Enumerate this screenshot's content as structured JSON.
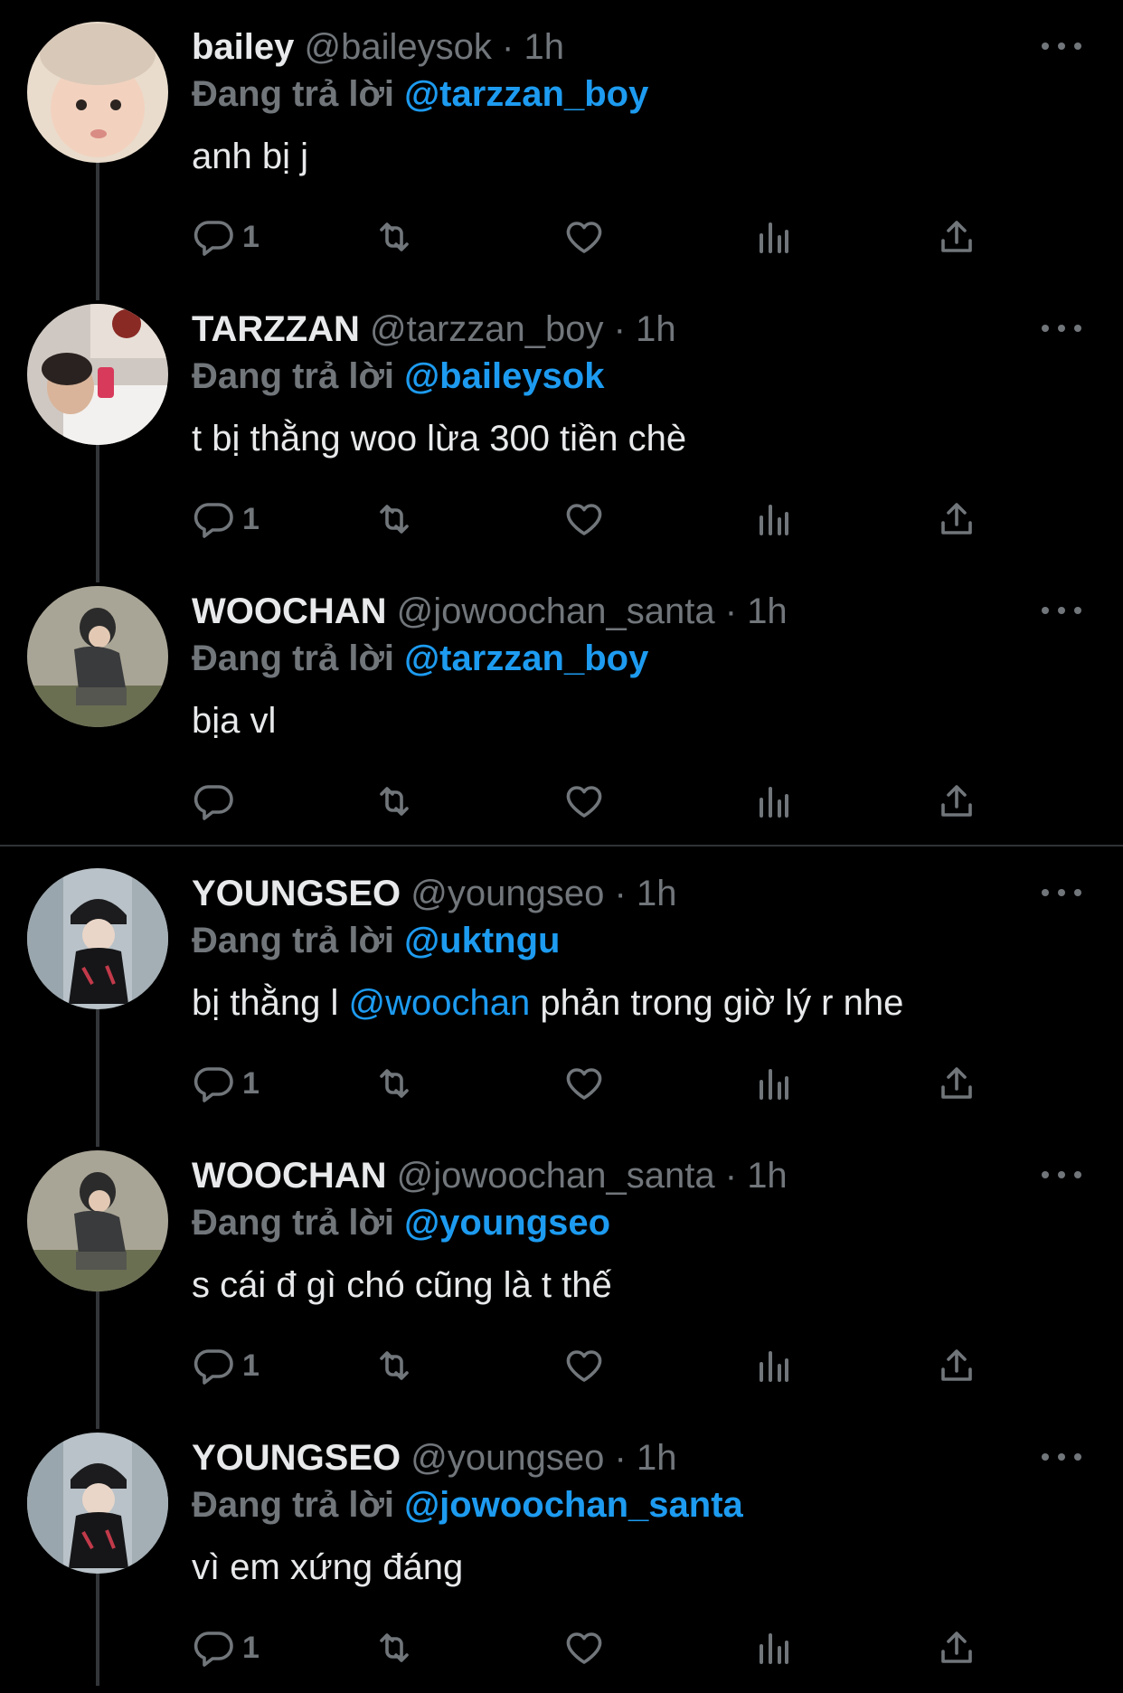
{
  "colors": {
    "background": "#000000",
    "text": "#e7e9ea",
    "muted": "#71767b",
    "accent": "#1d9bf0"
  },
  "tweets": [
    {
      "display_name": "bailey",
      "handle": "@baileysok",
      "dot": "·",
      "time": "1h",
      "reply_prefix": "Đang trả lời",
      "reply_to": "@tarzzan_boy",
      "text": "anh bị j",
      "reply_count": "1",
      "avatar": "avatar-baby"
    },
    {
      "display_name": "TARZZAN",
      "handle": "@tarzzan_boy",
      "dot": "·",
      "time": "1h",
      "reply_prefix": "Đang trả lời",
      "reply_to": "@baileysok",
      "text": "t bị thằng woo lừa 300 tiền chè",
      "reply_count": "1",
      "avatar": "avatar-mirror-selfie"
    },
    {
      "display_name": "WOOCHAN",
      "handle": "@jowoochan_santa",
      "dot": "·",
      "time": "1h",
      "reply_prefix": "Đang trả lời",
      "reply_to": "@tarzzan_boy",
      "text": "bịa vl",
      "reply_count": "",
      "avatar": "avatar-crouching"
    },
    {
      "display_name": "YOUNGSEO",
      "handle": "@youngseo",
      "dot": "·",
      "time": "1h",
      "reply_prefix": "Đang trả lời",
      "reply_to": "@uktngu",
      "text_before": "bị thằng l ",
      "text_mention": "@woochan",
      "text_after": " phản trong giờ lý r nhe",
      "reply_count": "1",
      "avatar": "avatar-beanie"
    },
    {
      "display_name": "WOOCHAN",
      "handle": "@jowoochan_santa",
      "dot": "·",
      "time": "1h",
      "reply_prefix": "Đang trả lời",
      "reply_to": "@youngseo",
      "text": "s cái đ gì chó cũng là t thế",
      "reply_count": "1",
      "avatar": "avatar-crouching"
    },
    {
      "display_name": "YOUNGSEO",
      "handle": "@youngseo",
      "dot": "·",
      "time": "1h",
      "reply_prefix": "Đang trả lời",
      "reply_to": "@jowoochan_santa",
      "text": "vì em xứng đáng",
      "reply_count": "1",
      "avatar": "avatar-beanie"
    }
  ],
  "icons": {
    "reply": "reply-icon",
    "retweet": "retweet-icon",
    "like": "heart-icon",
    "views": "views-icon",
    "share": "share-icon",
    "more": "more-icon"
  }
}
